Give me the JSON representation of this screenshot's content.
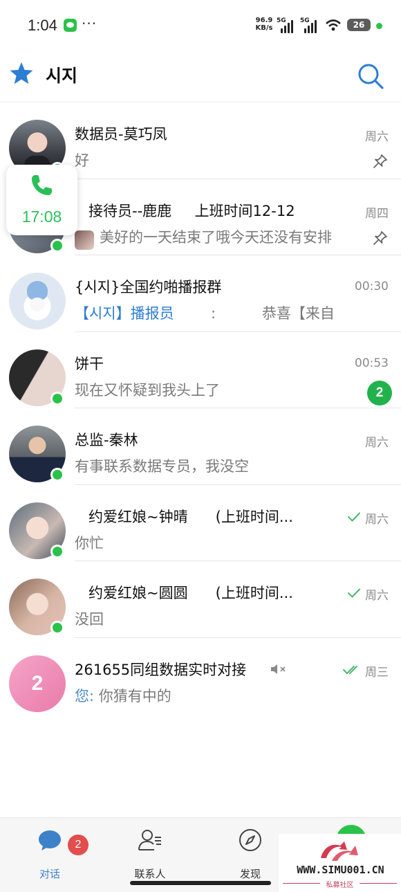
{
  "status_bar": {
    "time": "1:04",
    "dots": "···",
    "speed_value": "96.9",
    "speed_unit": "KB/s",
    "signal1_tag": "5G",
    "signal2_tag": "5G",
    "battery": "26"
  },
  "header": {
    "title": "시지"
  },
  "chats": [
    {
      "name": "数据员-莫巧凤",
      "preview": "好",
      "time": "周六"
    },
    {
      "name": "   接待员--鹿鹿     上班时间12-12",
      "preview": "美好的一天结束了哦今天还没有安排",
      "time": "周四"
    },
    {
      "name": "{시지}全国约啪播报群",
      "preview_highlight": "【시지】播报员",
      "preview_rest": "        :          恭喜【来自",
      "time": "00:30"
    },
    {
      "name": "饼干",
      "preview": "现在又怀疑到我头上了",
      "time": "00:53",
      "unread": "2"
    },
    {
      "name": "总监-秦林",
      "preview": "有事联系数据专员，我没空",
      "time": "周六"
    },
    {
      "name": "   约爱红娘~钟晴      (上班时间...",
      "preview": "你忙",
      "time": "周六"
    },
    {
      "name": "   约爱红娘~圆圆      (上班时间...",
      "preview": "没回",
      "time": "周六"
    },
    {
      "name": "261655同组数据实时对接",
      "sender": "您:",
      "preview": " 你猜有中的",
      "time": "周三",
      "avatar_text": "2"
    }
  ],
  "call_float": {
    "time": "17:08"
  },
  "bottom_nav": {
    "items": [
      {
        "label": "对话",
        "badge": "2"
      },
      {
        "label": "联系人"
      },
      {
        "label": "发现"
      }
    ]
  },
  "watermark": {
    "text": "WWW.SIMU001.CN",
    "sub": "私募社区"
  },
  "colors": {
    "accent": "#3d82c8",
    "online": "#2bc24a",
    "badge": "#22b24c",
    "nav_badge": "#e24d4d"
  }
}
